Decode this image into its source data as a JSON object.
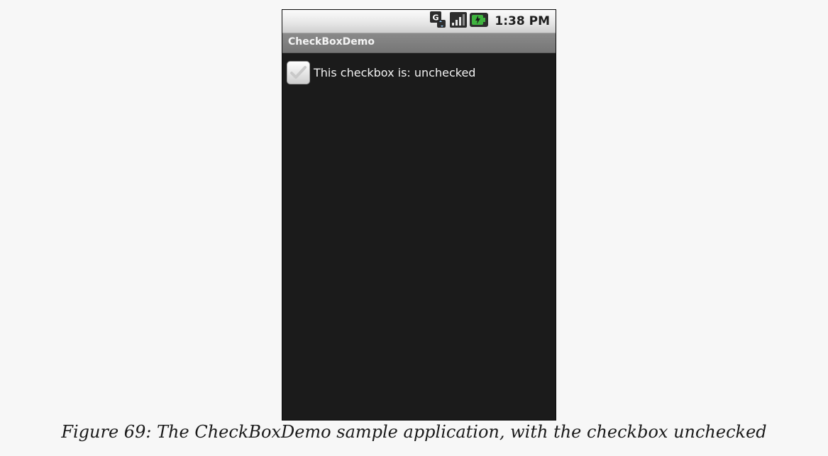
{
  "status_bar": {
    "time": "1:38 PM",
    "icons": [
      "network-type-icon",
      "signal-strength-icon",
      "battery-charging-icon"
    ],
    "network_label": "G"
  },
  "app": {
    "title": "CheckBoxDemo"
  },
  "checkbox": {
    "label": "This checkbox is: unchecked",
    "checked": false
  },
  "caption": "Figure 69: The CheckBoxDemo sample application, with the checkbox unchecked",
  "colors": {
    "page_background": "#f7f7f7",
    "screen_background": "#1b1b1b",
    "title_bar": "#808080",
    "status_bar": "#e8e8e8",
    "battery_accent": "#3fb33f"
  }
}
